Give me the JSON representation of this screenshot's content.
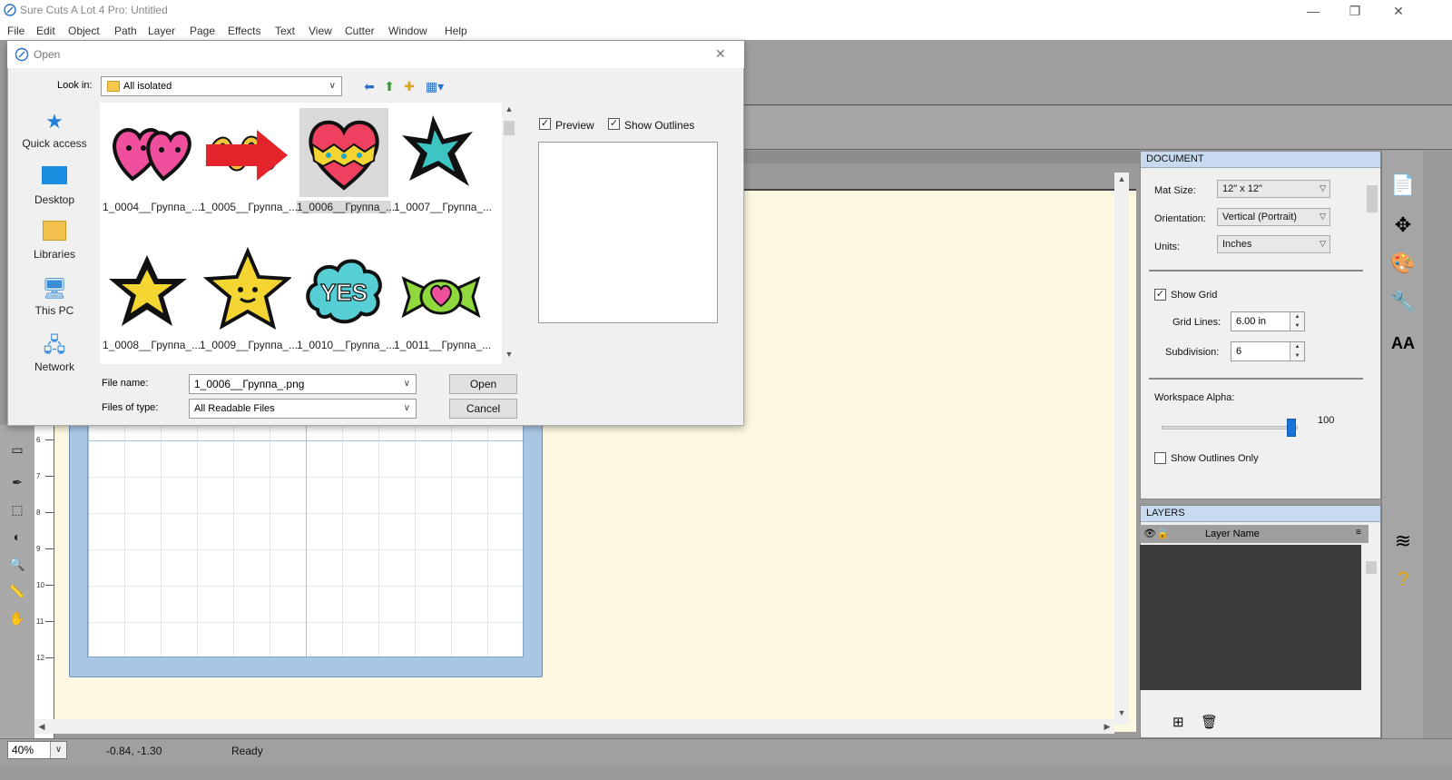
{
  "window": {
    "title": "Sure Cuts A Lot 4 Pro: Untitled"
  },
  "menubar": [
    "File",
    "Edit",
    "Object",
    "Path",
    "Layer",
    "Page",
    "Effects",
    "Text",
    "View",
    "Cutter",
    "Window",
    "Help"
  ],
  "dialog": {
    "title": "Open",
    "look_in_label": "Look in:",
    "look_in_value": "All isolated",
    "places": [
      "Quick access",
      "Desktop",
      "Libraries",
      "This PC",
      "Network"
    ],
    "files": [
      {
        "name": "1_0004__Группа_...",
        "icon": "double-heart-faces-icon",
        "selected": false
      },
      {
        "name": "1_0005__Группа_...",
        "icon": "swirl-scribble-icon",
        "selected": false
      },
      {
        "name": "1_0006__Группа_...",
        "icon": "patterned-heart-icon",
        "selected": true
      },
      {
        "name": "1_0007__Группа_...",
        "icon": "teal-star-icon",
        "selected": false
      },
      {
        "name": "1_0008__Группа_...",
        "icon": "yellow-star-icon",
        "selected": false
      },
      {
        "name": "1_0009__Группа_...",
        "icon": "smiling-star-icon",
        "selected": false
      },
      {
        "name": "1_0010__Группа_...",
        "icon": "yes-cloud-icon",
        "selected": false
      },
      {
        "name": "1_0011__Группа_...",
        "icon": "candy-heart-icon",
        "selected": false
      }
    ],
    "preview_label": "Preview",
    "preview_checked": true,
    "show_outlines_label": "Show Outlines",
    "show_outlines_checked": true,
    "file_name_label": "File name:",
    "file_name_value": "1_0006__Группа_.png",
    "files_of_type_label": "Files of type:",
    "files_of_type_value": "All Readable Files",
    "open_button": "Open",
    "cancel_button": "Cancel"
  },
  "document_panel": {
    "header": "DOCUMENT",
    "mat_size_label": "Mat Size:",
    "mat_size_value": "12\" x 12\"",
    "orientation_label": "Orientation:",
    "orientation_value": "Vertical (Portrait)",
    "units_label": "Units:",
    "units_value": "Inches",
    "show_grid_label": "Show Grid",
    "show_grid_checked": true,
    "grid_lines_label": "Grid Lines:",
    "grid_lines_value": "6.00 in",
    "subdivision_label": "Subdivision:",
    "subdivision_value": "6",
    "workspace_alpha_label": "Workspace Alpha:",
    "workspace_alpha_value": "100",
    "show_outlines_only_label": "Show Outlines Only",
    "show_outlines_only_checked": false
  },
  "layers_panel": {
    "header": "LAYERS",
    "column_name": "Layer Name"
  },
  "ruler": {
    "numbers": [
      "6",
      "7",
      "8",
      "9",
      "10",
      "11",
      "12"
    ]
  },
  "statusbar": {
    "zoom": "40%",
    "coords": "-0.84, -1.30",
    "status": "Ready"
  },
  "colors": {
    "accent": "#1a73d9",
    "panel_header": "#c8daf0",
    "workspace": "#fdf8e1"
  }
}
